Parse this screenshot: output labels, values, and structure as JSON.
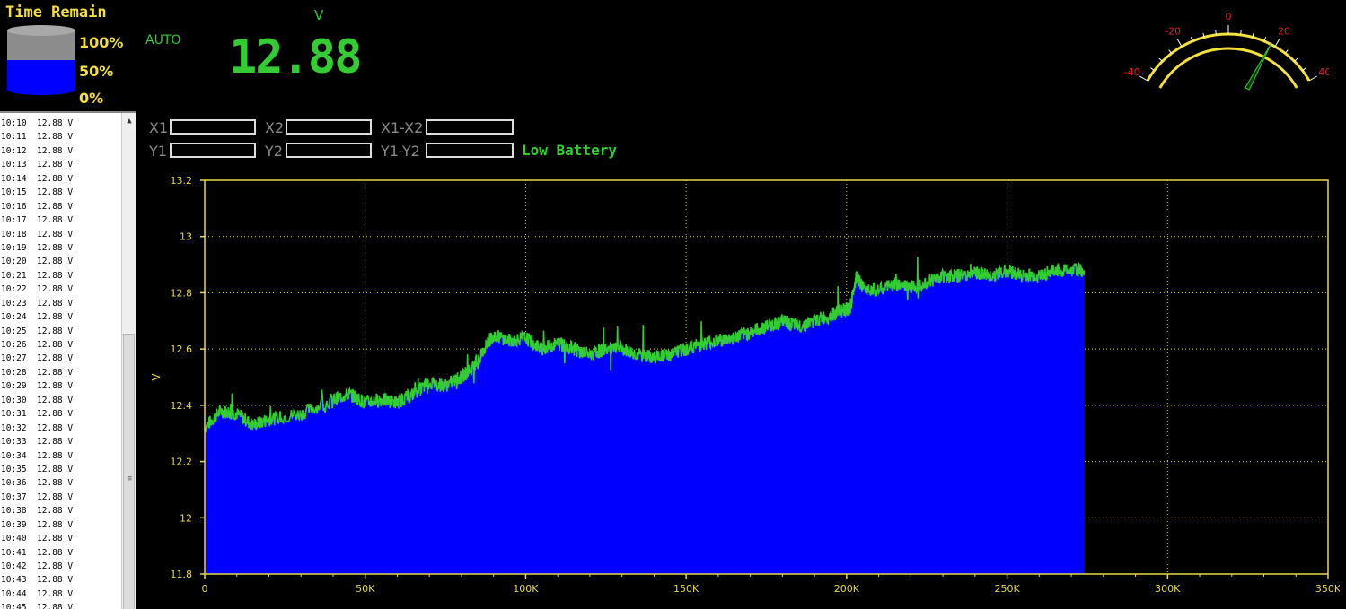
{
  "header": {
    "time_remain_title": "Time Remain",
    "pct_100": "100%",
    "pct_50": "50%",
    "pct_0": "0%",
    "mode": "AUTO",
    "unit": "V",
    "reading": "12.88",
    "battery_level_fraction": 0.5
  },
  "gauge": {
    "tick_labels": [
      "-40",
      "-20",
      "0",
      "20",
      "40"
    ],
    "needle_value": 18,
    "range": [
      -40,
      40
    ]
  },
  "log": {
    "rows": [
      "10:10  12.88 V",
      "10:11  12.88 V",
      "10:12  12.88 V",
      "10:13  12.88 V",
      "10:14  12.88 V",
      "10:15  12.88 V",
      "10:16  12.88 V",
      "10:17  12.88 V",
      "10:18  12.88 V",
      "10:19  12.88 V",
      "10:20  12.88 V",
      "10:21  12.88 V",
      "10:22  12.88 V",
      "10:23  12.88 V",
      "10:24  12.88 V",
      "10:25  12.88 V",
      "10:26  12.88 V",
      "10:27  12.88 V",
      "10:28  12.88 V",
      "10:29  12.88 V",
      "10:30  12.88 V",
      "10:31  12.88 V",
      "10:32  12.88 V",
      "10:33  12.88 V",
      "10:34  12.88 V",
      "10:35  12.88 V",
      "10:36  12.88 V",
      "10:37  12.88 V",
      "10:38  12.88 V",
      "10:39  12.88 V",
      "10:40  12.88 V",
      "10:41  12.88 V",
      "10:42  12.88 V",
      "10:43  12.88 V",
      "10:44  12.88 V",
      "10:45  12.88 V"
    ]
  },
  "cursors": {
    "x1": "X1",
    "x2": "X2",
    "x1_x2": "X1-X2",
    "y1": "Y1",
    "y2": "Y2",
    "y1_y2": "Y1-Y2",
    "x1_value": "",
    "x2_value": "",
    "x1_x2_value": "",
    "y1_value": "",
    "y2_value": "",
    "y1_y2_value": "",
    "status": "Low Battery"
  },
  "colors": {
    "trace": "#33cc33",
    "fill": "#0000ff",
    "axis": "#e6d84a",
    "grid": "#d8d070",
    "background": "#000000"
  },
  "chart_data": {
    "type": "area",
    "ylabel": "V",
    "xlim": [
      0,
      350000
    ],
    "ylim": [
      11.8,
      13.2
    ],
    "x_ticks": [
      "0",
      "50K",
      "100K",
      "150K",
      "200K",
      "250K",
      "300K",
      "350K"
    ],
    "y_ticks": [
      "13.2",
      "13",
      "12.8",
      "12.6",
      "12.4",
      "12.2",
      "12",
      "11.8"
    ],
    "grid": true,
    "series": [
      {
        "x": [
          0,
          5000,
          10000,
          15000,
          20000,
          30000,
          40000,
          45000,
          50000,
          55000,
          60000,
          65000,
          70000,
          75000,
          80000,
          85000,
          88000,
          90000,
          95000,
          100000,
          105000,
          110000,
          115000,
          120000,
          125000,
          130000,
          135000,
          140000,
          145000,
          150000,
          155000,
          160000,
          165000,
          170000,
          175000,
          180000,
          185000,
          190000,
          195000,
          199000,
          201000,
          203000,
          205000,
          210000,
          215000,
          220000,
          225000,
          230000,
          235000,
          240000,
          245000,
          250000,
          255000,
          260000,
          265000,
          270000,
          274000
        ],
        "y": [
          12.32,
          12.38,
          12.37,
          12.33,
          12.35,
          12.37,
          12.42,
          12.44,
          12.41,
          12.42,
          12.41,
          12.44,
          12.48,
          12.47,
          12.5,
          12.55,
          12.62,
          12.65,
          12.63,
          12.64,
          12.6,
          12.62,
          12.6,
          12.58,
          12.6,
          12.6,
          12.58,
          12.57,
          12.58,
          12.6,
          12.62,
          12.63,
          12.64,
          12.66,
          12.68,
          12.7,
          12.68,
          12.7,
          12.72,
          12.74,
          12.74,
          12.86,
          12.82,
          12.81,
          12.83,
          12.82,
          12.84,
          12.86,
          12.86,
          12.87,
          12.86,
          12.88,
          12.86,
          12.86,
          12.88,
          12.88,
          12.88
        ]
      }
    ]
  }
}
